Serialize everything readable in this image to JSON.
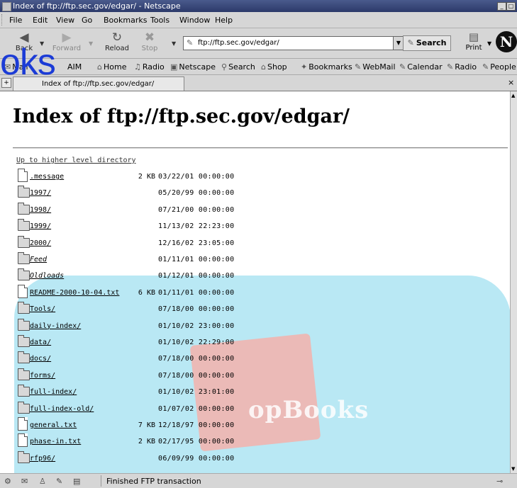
{
  "window": {
    "title": "Index of ftp://ftp.sec.gov/edgar/ - Netscape",
    "min_label": "_",
    "max_label": "□"
  },
  "menu": [
    "File",
    "Edit",
    "View",
    "Go",
    "Bookmarks",
    "Tools",
    "Window",
    "Help"
  ],
  "nav": {
    "back": "Back",
    "forward": "Forward",
    "reload": "Reload",
    "stop": "Stop",
    "url": "ftp://ftp.sec.gov/edgar/",
    "search": "Search",
    "print": "Print",
    "logo": "N"
  },
  "personal_toolbar": [
    "Mail",
    "AIM",
    "Home",
    "Radio",
    "Netscape",
    "Search",
    "Shop",
    "Bookmarks",
    "WebMail",
    "Calendar",
    "Radio",
    "People"
  ],
  "tab": {
    "title": "Index of ftp://ftp.sec.gov/edgar/",
    "close": "×"
  },
  "page": {
    "title": "Index of ftp://ftp.sec.gov/edgar/",
    "up_link": "Up to higher level directory",
    "entries": [
      {
        "name": ".message",
        "type": "file",
        "size": "2 KB",
        "date": "03/22/01 00:00:00",
        "italic": false
      },
      {
        "name": "1997/",
        "type": "folder",
        "size": "",
        "date": "05/20/99 00:00:00",
        "italic": false
      },
      {
        "name": "1998/",
        "type": "folder",
        "size": "",
        "date": "07/21/00 00:00:00",
        "italic": false
      },
      {
        "name": "1999/",
        "type": "folder",
        "size": "",
        "date": "11/13/02 22:23:00",
        "italic": false
      },
      {
        "name": "2000/",
        "type": "folder",
        "size": "",
        "date": "12/16/02 23:05:00",
        "italic": false
      },
      {
        "name": "Feed",
        "type": "folder",
        "size": "",
        "date": "01/11/01 00:00:00",
        "italic": true
      },
      {
        "name": "Oldloads",
        "type": "folder",
        "size": "",
        "date": "01/12/01 00:00:00",
        "italic": true
      },
      {
        "name": "README-2000-10-04.txt",
        "type": "file",
        "size": "6 KB",
        "date": "01/11/01 00:00:00",
        "italic": false
      },
      {
        "name": "Tools/",
        "type": "folder",
        "size": "",
        "date": "07/18/00 00:00:00",
        "italic": false
      },
      {
        "name": "daily-index/",
        "type": "folder",
        "size": "",
        "date": "01/10/02 23:00:00",
        "italic": false
      },
      {
        "name": "data/",
        "type": "folder",
        "size": "",
        "date": "01/10/02 22:29:00",
        "italic": false
      },
      {
        "name": "docs/",
        "type": "folder",
        "size": "",
        "date": "07/18/00 00:00:00",
        "italic": false
      },
      {
        "name": "forms/",
        "type": "folder",
        "size": "",
        "date": "07/18/00 00:00:00",
        "italic": false
      },
      {
        "name": "full-index/",
        "type": "folder",
        "size": "",
        "date": "01/10/02 23:01:00",
        "italic": false
      },
      {
        "name": "full-index-old/",
        "type": "folder",
        "size": "",
        "date": "01/07/02 00:00:00",
        "italic": false
      },
      {
        "name": "general.txt",
        "type": "file",
        "size": "7 KB",
        "date": "12/18/97 00:00:00",
        "italic": false
      },
      {
        "name": "phase-in.txt",
        "type": "file",
        "size": "2 KB",
        "date": "02/17/95 00:00:00",
        "italic": false
      },
      {
        "name": "rfp96/",
        "type": "folder",
        "size": "",
        "date": "06/09/99 00:00:00",
        "italic": false
      }
    ]
  },
  "watermark": "opBooks",
  "overlay": "oks",
  "status": {
    "text": "Finished FTP transaction"
  }
}
